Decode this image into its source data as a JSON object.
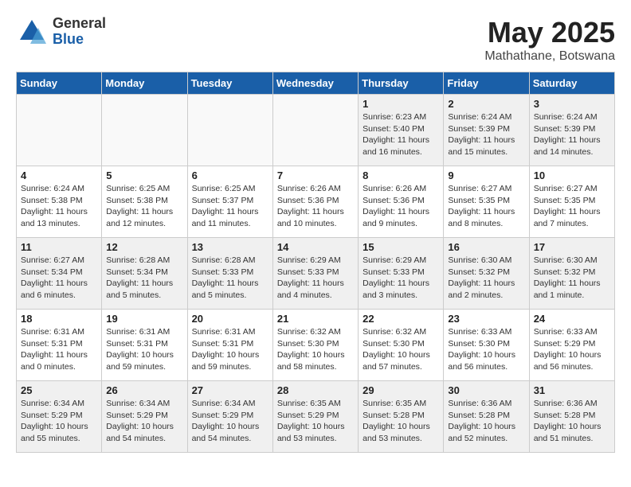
{
  "header": {
    "logo_general": "General",
    "logo_blue": "Blue",
    "month": "May 2025",
    "location": "Mathathane, Botswana"
  },
  "weekdays": [
    "Sunday",
    "Monday",
    "Tuesday",
    "Wednesday",
    "Thursday",
    "Friday",
    "Saturday"
  ],
  "weeks": [
    [
      {
        "day": "",
        "empty": true
      },
      {
        "day": "",
        "empty": true
      },
      {
        "day": "",
        "empty": true
      },
      {
        "day": "",
        "empty": true
      },
      {
        "day": "1",
        "sunrise": "6:23 AM",
        "sunset": "5:40 PM",
        "daylight": "11 hours and 16 minutes."
      },
      {
        "day": "2",
        "sunrise": "6:24 AM",
        "sunset": "5:39 PM",
        "daylight": "11 hours and 15 minutes."
      },
      {
        "day": "3",
        "sunrise": "6:24 AM",
        "sunset": "5:39 PM",
        "daylight": "11 hours and 14 minutes."
      }
    ],
    [
      {
        "day": "4",
        "sunrise": "6:24 AM",
        "sunset": "5:38 PM",
        "daylight": "11 hours and 13 minutes."
      },
      {
        "day": "5",
        "sunrise": "6:25 AM",
        "sunset": "5:38 PM",
        "daylight": "11 hours and 12 minutes."
      },
      {
        "day": "6",
        "sunrise": "6:25 AM",
        "sunset": "5:37 PM",
        "daylight": "11 hours and 11 minutes."
      },
      {
        "day": "7",
        "sunrise": "6:26 AM",
        "sunset": "5:36 PM",
        "daylight": "11 hours and 10 minutes."
      },
      {
        "day": "8",
        "sunrise": "6:26 AM",
        "sunset": "5:36 PM",
        "daylight": "11 hours and 9 minutes."
      },
      {
        "day": "9",
        "sunrise": "6:27 AM",
        "sunset": "5:35 PM",
        "daylight": "11 hours and 8 minutes."
      },
      {
        "day": "10",
        "sunrise": "6:27 AM",
        "sunset": "5:35 PM",
        "daylight": "11 hours and 7 minutes."
      }
    ],
    [
      {
        "day": "11",
        "sunrise": "6:27 AM",
        "sunset": "5:34 PM",
        "daylight": "11 hours and 6 minutes."
      },
      {
        "day": "12",
        "sunrise": "6:28 AM",
        "sunset": "5:34 PM",
        "daylight": "11 hours and 5 minutes."
      },
      {
        "day": "13",
        "sunrise": "6:28 AM",
        "sunset": "5:33 PM",
        "daylight": "11 hours and 5 minutes."
      },
      {
        "day": "14",
        "sunrise": "6:29 AM",
        "sunset": "5:33 PM",
        "daylight": "11 hours and 4 minutes."
      },
      {
        "day": "15",
        "sunrise": "6:29 AM",
        "sunset": "5:33 PM",
        "daylight": "11 hours and 3 minutes."
      },
      {
        "day": "16",
        "sunrise": "6:30 AM",
        "sunset": "5:32 PM",
        "daylight": "11 hours and 2 minutes."
      },
      {
        "day": "17",
        "sunrise": "6:30 AM",
        "sunset": "5:32 PM",
        "daylight": "11 hours and 1 minute."
      }
    ],
    [
      {
        "day": "18",
        "sunrise": "6:31 AM",
        "sunset": "5:31 PM",
        "daylight": "11 hours and 0 minutes."
      },
      {
        "day": "19",
        "sunrise": "6:31 AM",
        "sunset": "5:31 PM",
        "daylight": "10 hours and 59 minutes."
      },
      {
        "day": "20",
        "sunrise": "6:31 AM",
        "sunset": "5:31 PM",
        "daylight": "10 hours and 59 minutes."
      },
      {
        "day": "21",
        "sunrise": "6:32 AM",
        "sunset": "5:30 PM",
        "daylight": "10 hours and 58 minutes."
      },
      {
        "day": "22",
        "sunrise": "6:32 AM",
        "sunset": "5:30 PM",
        "daylight": "10 hours and 57 minutes."
      },
      {
        "day": "23",
        "sunrise": "6:33 AM",
        "sunset": "5:30 PM",
        "daylight": "10 hours and 56 minutes."
      },
      {
        "day": "24",
        "sunrise": "6:33 AM",
        "sunset": "5:29 PM",
        "daylight": "10 hours and 56 minutes."
      }
    ],
    [
      {
        "day": "25",
        "sunrise": "6:34 AM",
        "sunset": "5:29 PM",
        "daylight": "10 hours and 55 minutes."
      },
      {
        "day": "26",
        "sunrise": "6:34 AM",
        "sunset": "5:29 PM",
        "daylight": "10 hours and 54 minutes."
      },
      {
        "day": "27",
        "sunrise": "6:34 AM",
        "sunset": "5:29 PM",
        "daylight": "10 hours and 54 minutes."
      },
      {
        "day": "28",
        "sunrise": "6:35 AM",
        "sunset": "5:29 PM",
        "daylight": "10 hours and 53 minutes."
      },
      {
        "day": "29",
        "sunrise": "6:35 AM",
        "sunset": "5:28 PM",
        "daylight": "10 hours and 53 minutes."
      },
      {
        "day": "30",
        "sunrise": "6:36 AM",
        "sunset": "5:28 PM",
        "daylight": "10 hours and 52 minutes."
      },
      {
        "day": "31",
        "sunrise": "6:36 AM",
        "sunset": "5:28 PM",
        "daylight": "10 hours and 51 minutes."
      }
    ]
  ]
}
